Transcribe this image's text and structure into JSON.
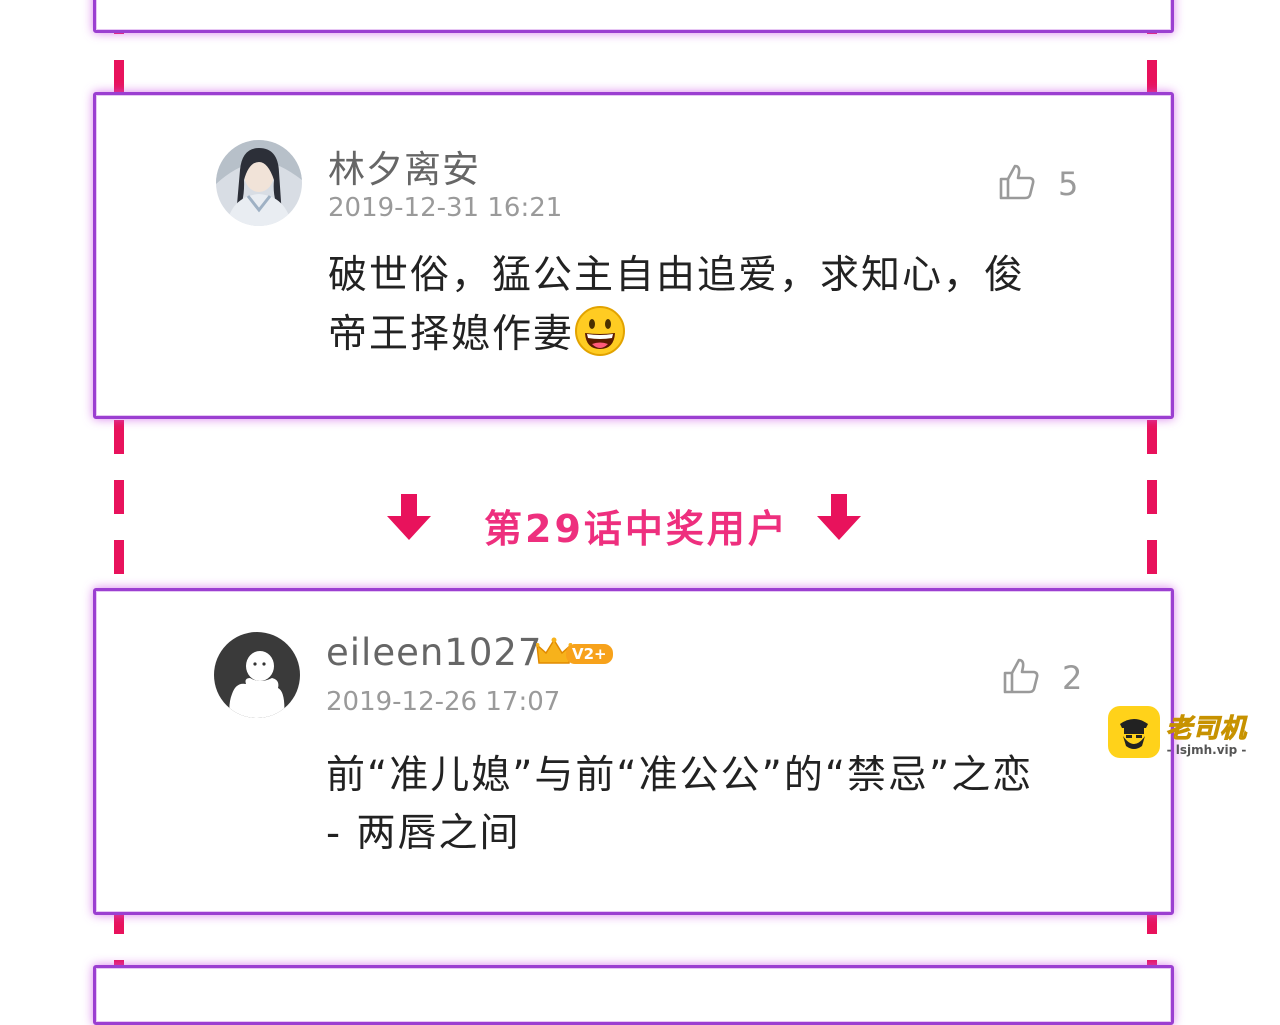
{
  "comments": [
    {
      "username": "林夕离安",
      "timestamp": "2019-12-31 16:21",
      "likes": "5",
      "text": "破世俗，猛公主自由追爱，求知心，俊帝王择媳作妻",
      "emoji": "grinning-face-emoji"
    },
    {
      "username": "eileen1027",
      "badge": "V2+",
      "timestamp": "2019-12-26 17:07",
      "likes": "2",
      "text": "前“准儿媳”与前“准公公”的“禁忌”之恋 - 两唇之间"
    }
  ],
  "divider": {
    "label": "第29话中奖用户"
  },
  "watermark": {
    "name": "老司机",
    "url": "- lsjmh.vip -"
  },
  "colors": {
    "card_border": "#9b3fd1",
    "rail": "#e8125c",
    "divider_text": "#ee2f7e",
    "badge": "#f7a21b"
  }
}
